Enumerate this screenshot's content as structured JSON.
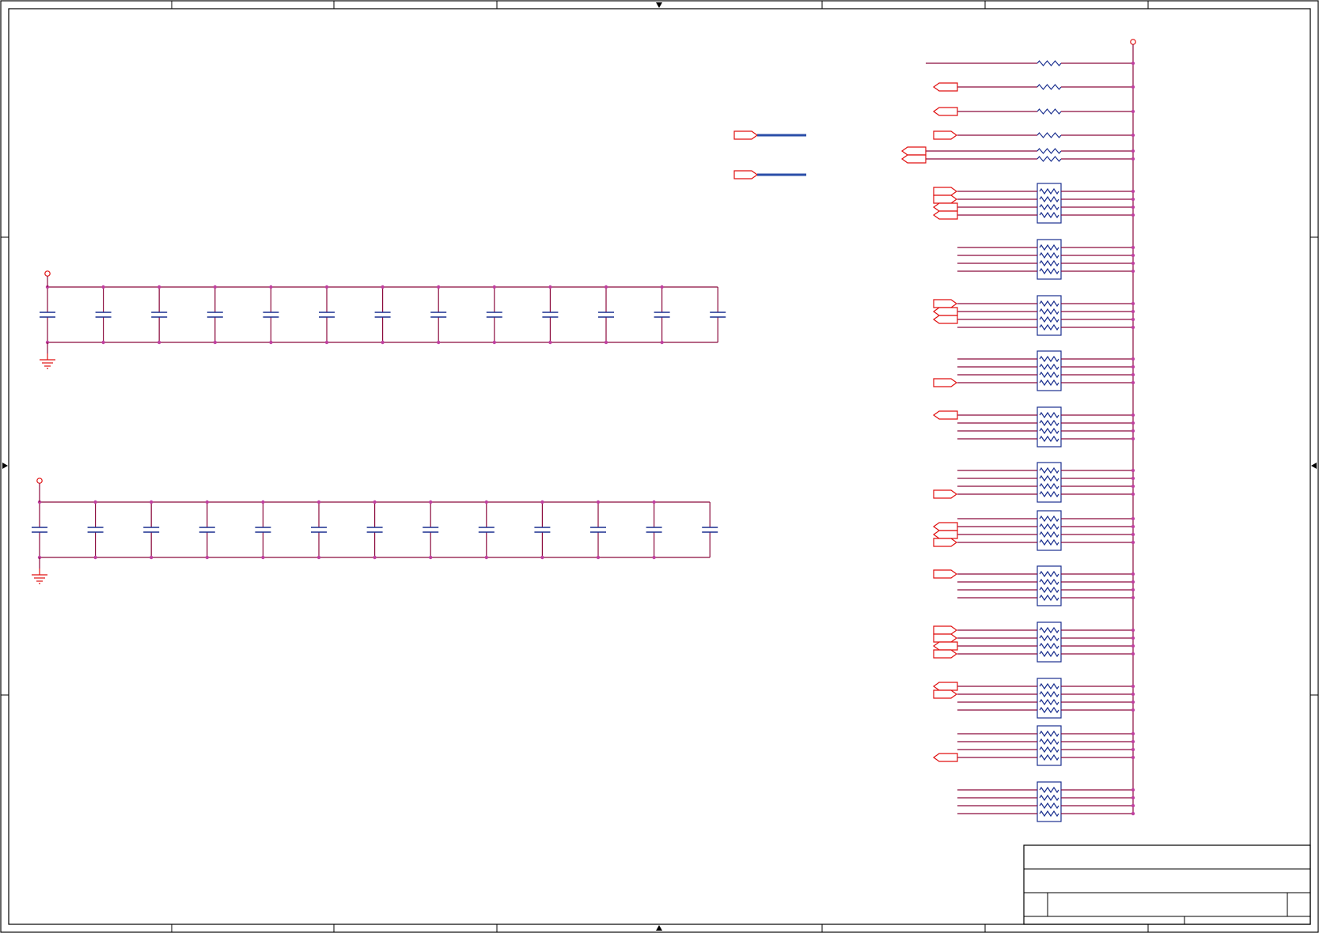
{
  "colors": {
    "background": "#ffffff",
    "border": "#000000",
    "wire": "#8b0a3c",
    "junction": "#c040a0",
    "part": "#1a2f8f",
    "power": "#e01010",
    "bus": "#2a4ea8"
  },
  "icons": {
    "port": "port-flag-icon",
    "power": "power-circle-icon",
    "ground": "ground-icon",
    "capacitor": "capacitor-icon",
    "resistor": "resistor-icon",
    "resistor_array": "resistor-array-icon",
    "arrow": "arrow-marker-icon"
  },
  "decoupling_banks": [
    {
      "name": "upper-bank",
      "capacitor_count": 13
    },
    {
      "name": "lower-bank",
      "capacitor_count": 13
    }
  ],
  "pullup_network": {
    "single_resistors": 6,
    "resistor_arrays": 12,
    "pins_per_array": 4
  }
}
